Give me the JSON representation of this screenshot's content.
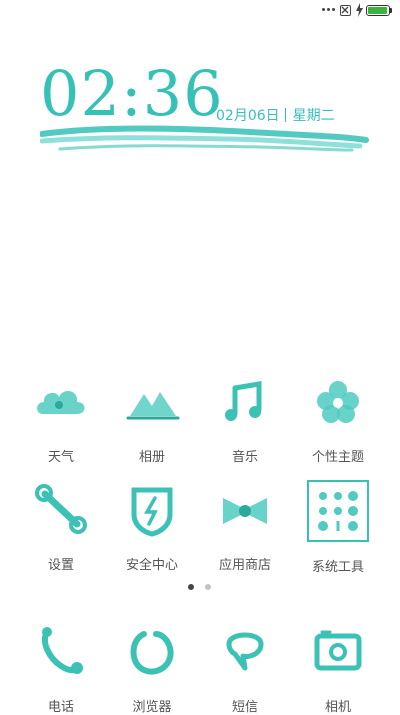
{
  "status_bar": {
    "icons": [
      "more-dots-icon",
      "no-sim-icon",
      "charging-bolt-icon",
      "battery-icon"
    ],
    "battery_level": 1.0,
    "battery_color": "#3cb43c"
  },
  "clock": {
    "time": "02:36",
    "date": "02月06日",
    "weekday": "星期二",
    "accent_color": "#35c1b6"
  },
  "apps_row1": [
    {
      "label": "天气",
      "icon": "weather-cloud-icon"
    },
    {
      "label": "相册",
      "icon": "gallery-mountain-icon"
    },
    {
      "label": "音乐",
      "icon": "music-note-icon"
    },
    {
      "label": "个性主题",
      "icon": "theme-flower-icon"
    }
  ],
  "apps_row2": [
    {
      "label": "设置",
      "icon": "settings-wrench-icon"
    },
    {
      "label": "安全中心",
      "icon": "security-shield-icon"
    },
    {
      "label": "应用商店",
      "icon": "app-store-bowtie-icon"
    },
    {
      "label": "系统工具",
      "icon": "system-tools-grid-icon"
    }
  ],
  "pager": {
    "pages": 2,
    "current": 1
  },
  "dock": [
    {
      "label": "电话",
      "icon": "phone-icon"
    },
    {
      "label": "浏览器",
      "icon": "browser-icon"
    },
    {
      "label": "短信",
      "icon": "messages-bubble-icon"
    },
    {
      "label": "相机",
      "icon": "camera-icon"
    }
  ]
}
